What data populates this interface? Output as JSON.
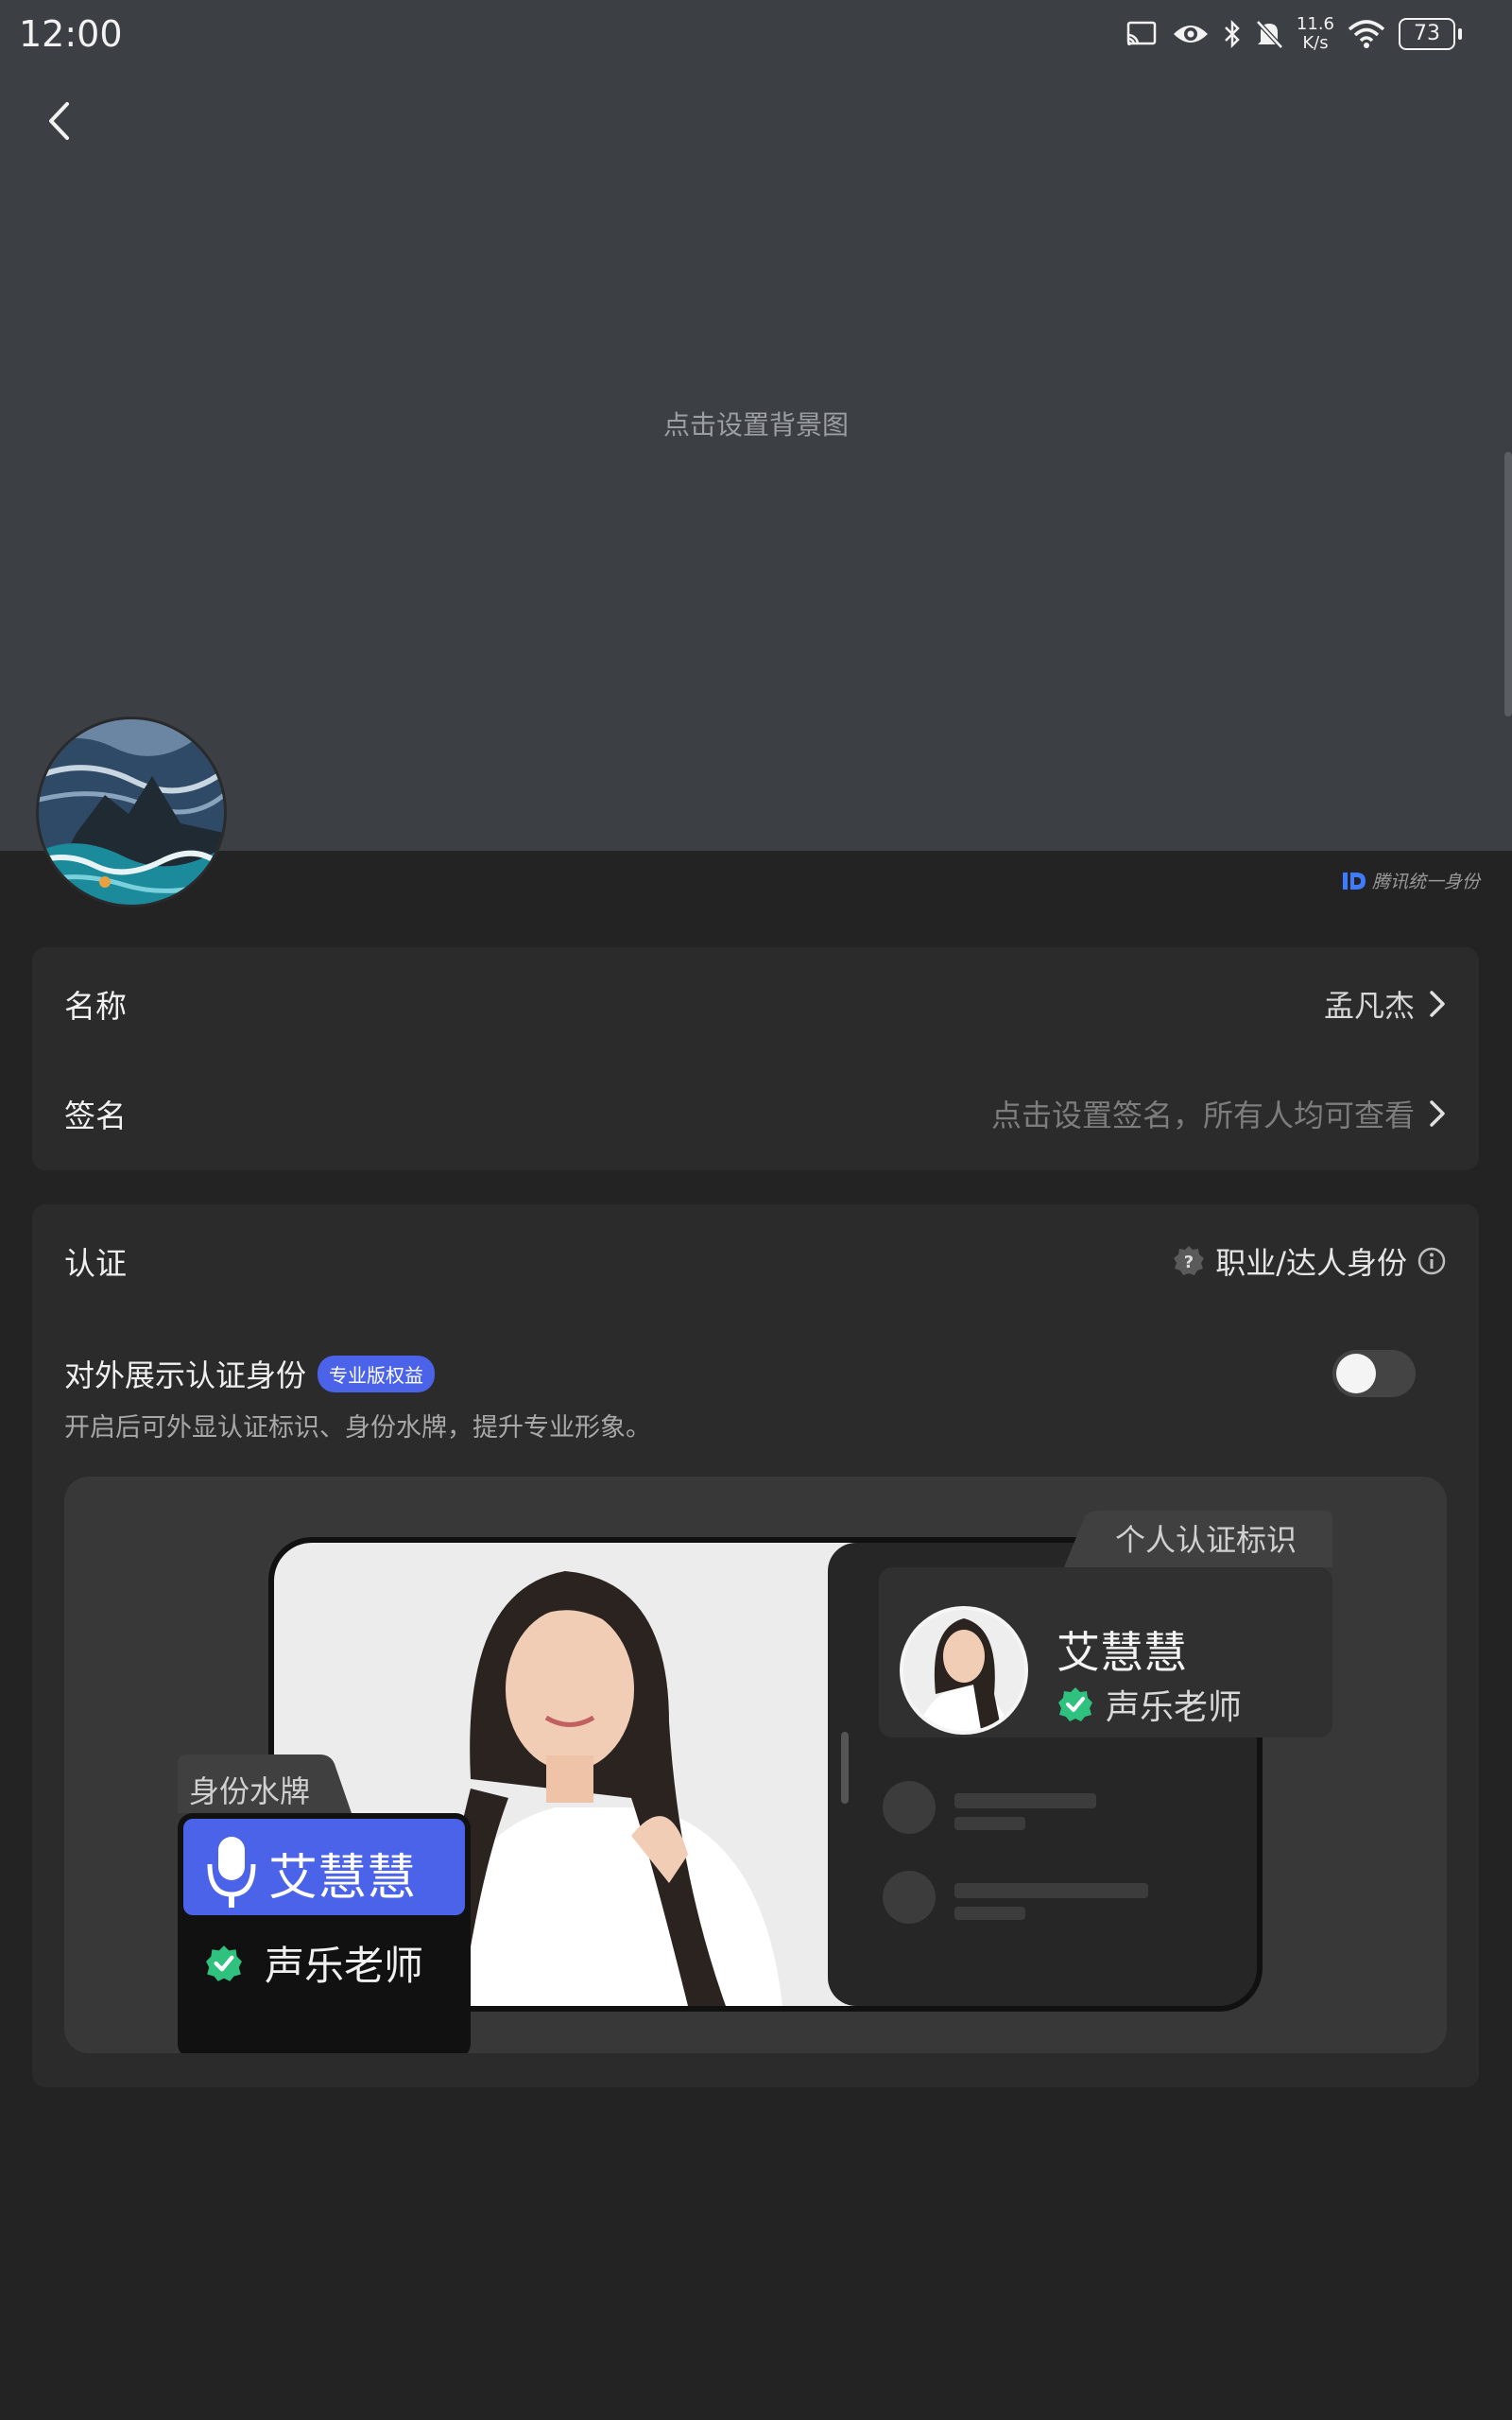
{
  "status_bar": {
    "time": "12:00",
    "net_speed_value": "11.6",
    "net_speed_unit": "K/s",
    "battery": "73"
  },
  "cover": {
    "hint": "点击设置背景图"
  },
  "brand": {
    "label": "腾讯统一身份"
  },
  "profile": {
    "name_label": "名称",
    "name_value": "孟凡杰",
    "signature_label": "签名",
    "signature_placeholder": "点击设置签名，所有人均可查看"
  },
  "certification": {
    "label": "认证",
    "role": "职业/达人身份",
    "display_title": "对外展示认证身份",
    "pro_badge": "专业版权益",
    "display_desc": "开启后可外显认证标识、身份水牌，提升专业形象。",
    "toggle_on": false
  },
  "preview": {
    "personal_badge_tab": "个人认证标识",
    "badge_name": "艾慧慧",
    "badge_title": "声乐老师",
    "watermark_tab": "身份水牌",
    "watermark_name": "艾慧慧",
    "watermark_title": "声乐老师"
  },
  "colors": {
    "cover_bg": "#3c3f44",
    "page_bg": "#232323",
    "card_bg": "#2b2b2b",
    "accent_blue": "#4b63e8",
    "verified_green": "#2ec27e"
  }
}
